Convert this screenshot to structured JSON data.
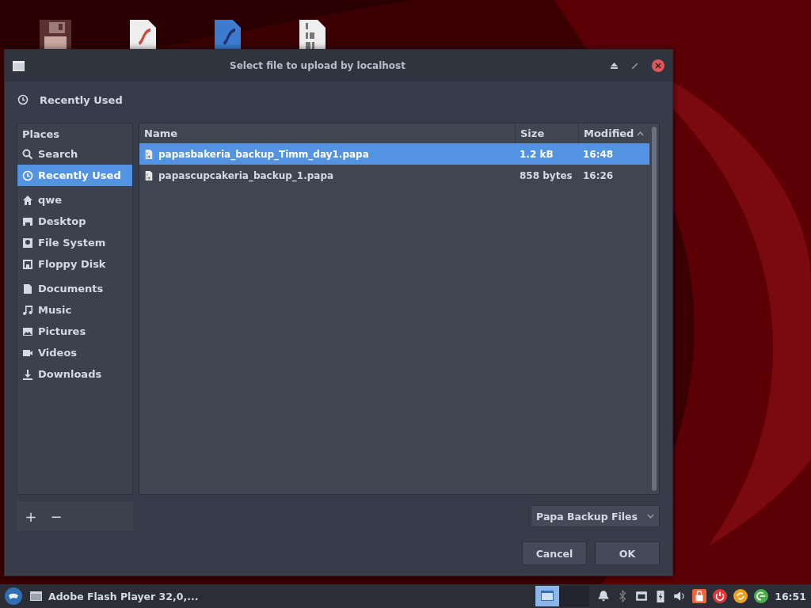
{
  "window": {
    "title": "Select file to upload by localhost"
  },
  "location": {
    "label": "Recently Used"
  },
  "places": {
    "heading": "Places",
    "groups": [
      [
        {
          "label": "Search",
          "selected": false
        },
        {
          "label": "Recently Used",
          "selected": true
        }
      ],
      [
        {
          "label": "qwe",
          "selected": false
        },
        {
          "label": "Desktop",
          "selected": false
        },
        {
          "label": "File System",
          "selected": false
        },
        {
          "label": "Floppy Disk",
          "selected": false
        }
      ],
      [
        {
          "label": "Documents",
          "selected": false
        },
        {
          "label": "Music",
          "selected": false
        },
        {
          "label": "Pictures",
          "selected": false
        },
        {
          "label": "Videos",
          "selected": false
        },
        {
          "label": "Downloads",
          "selected": false
        }
      ]
    ]
  },
  "places_buttons": [
    "+",
    "−"
  ],
  "table": {
    "columns": [
      {
        "label": "Name",
        "sorted": false
      },
      {
        "label": "Size",
        "sorted": false
      },
      {
        "label": "Modified",
        "sorted": true
      }
    ],
    "rows": [
      {
        "name": "papasbakeria_backup_Timm_day1.papa",
        "size": "1.2 kB",
        "modified": "16:48",
        "selected": true
      },
      {
        "name": "papascupcakeria_backup_1.papa",
        "size": "858 bytes",
        "modified": "16:26",
        "selected": false
      }
    ]
  },
  "filter": {
    "value": "Papa Backup Files"
  },
  "buttons": [
    "Cancel",
    "OK"
  ],
  "taskbar": {
    "task": "Adobe Flash Player 32,0,...",
    "clock": "16:51"
  }
}
